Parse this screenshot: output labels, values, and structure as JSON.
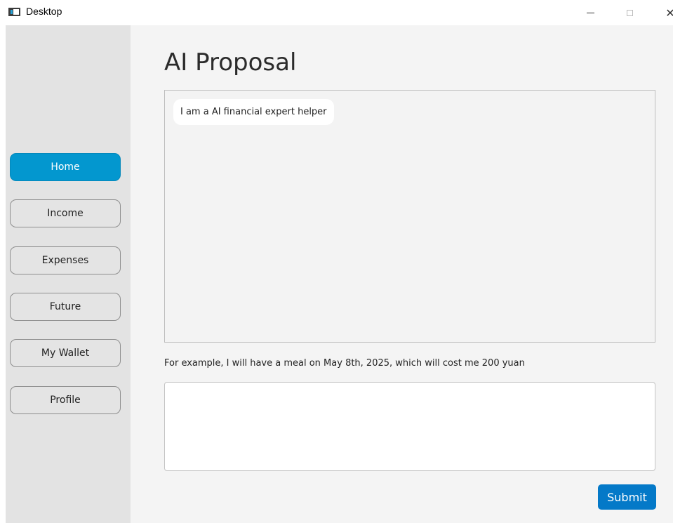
{
  "window": {
    "title": "Desktop",
    "minimize_glyph": "",
    "close_glyph": "✕"
  },
  "sidebar": {
    "items": [
      {
        "label": "Home",
        "active": true
      },
      {
        "label": "Income",
        "active": false
      },
      {
        "label": "Expenses",
        "active": false
      },
      {
        "label": "Future",
        "active": false
      },
      {
        "label": "My Wallet",
        "active": false
      },
      {
        "label": "Profile",
        "active": false
      }
    ]
  },
  "main": {
    "title": "AI Proposal",
    "messages": [
      {
        "text": "I am a AI financial expert helper"
      }
    ],
    "hint": "For example, I will have a meal on May 8th, 2025, which will cost me 200 yuan",
    "input": {
      "value": "",
      "placeholder": ""
    },
    "submit_label": "Submit"
  },
  "colors": {
    "accent": "#0397cf",
    "submit": "#0479c8",
    "sidebar_bg": "#e3e3e3",
    "main_bg": "#f4f4f4"
  }
}
